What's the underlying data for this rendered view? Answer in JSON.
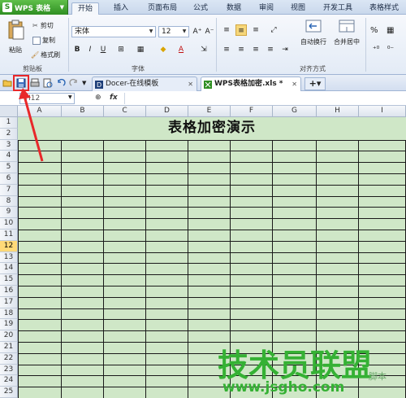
{
  "app": {
    "title": "WPS 表格",
    "logo_letter": "S"
  },
  "menu_tabs": [
    "开始",
    "插入",
    "页面布局",
    "公式",
    "数据",
    "审阅",
    "视图",
    "开发工具",
    "表格样式"
  ],
  "ribbon": {
    "clipboard": {
      "paste": "粘贴",
      "cut": "剪切",
      "copy": "复制",
      "format_painter": "格式刷",
      "label": "剪贴板"
    },
    "font": {
      "name": "宋体",
      "size": "12",
      "grow": "A⁺",
      "shrink": "A⁻",
      "bold": "B",
      "italic": "I",
      "underline": "U",
      "label": "字体"
    },
    "alignment": {
      "wrap": "自动换行",
      "merge": "合并居中",
      "label": "对齐方式"
    },
    "number": {
      "percent": "%"
    }
  },
  "doc_tabs": [
    {
      "label": "Docer-在线模板",
      "active": false
    },
    {
      "label": "WPS表格加密.xls *",
      "active": true
    }
  ],
  "name_box": "H12",
  "fx": "fx",
  "columns": [
    "A",
    "B",
    "C",
    "D",
    "E",
    "F",
    "G",
    "H",
    "I"
  ],
  "rows": [
    "1",
    "2",
    "3",
    "4",
    "5",
    "6",
    "7",
    "8",
    "9",
    "10",
    "11",
    "12",
    "13",
    "14",
    "15",
    "16",
    "17",
    "18",
    "19",
    "20",
    "21",
    "22",
    "23",
    "24",
    "25"
  ],
  "selected_row": "12",
  "sheet_title": "表格加密演示",
  "colors": {
    "cell_fill": "#cfe7c7",
    "highlight": "#e8282a",
    "watermark": "#35b134"
  },
  "watermark": {
    "main": "技术员联盟",
    "sub": "www.jsgho.com",
    "tag": "脚本"
  }
}
